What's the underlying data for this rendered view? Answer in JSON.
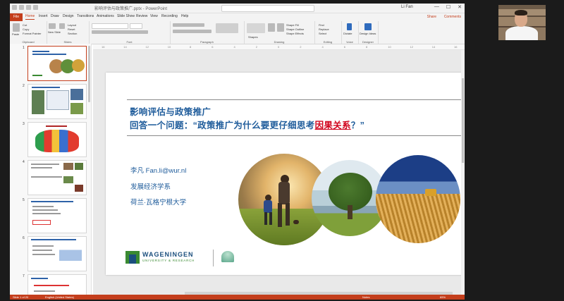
{
  "titlebar": {
    "doc_title": "影响评估与政策推广.pptx - PowerPoint",
    "user_name": "Li Fan",
    "minimize": "—",
    "maximize": "☐",
    "close": "✕"
  },
  "tabs": {
    "file": "File",
    "items": [
      "Home",
      "Insert",
      "Draw",
      "Design",
      "Transitions",
      "Animations",
      "Slide Show",
      "Review",
      "View",
      "Recording",
      "Help"
    ],
    "share": "Share",
    "comments": "Comments"
  },
  "ribbon": {
    "groups": [
      {
        "name": "Clipboard",
        "labels": [
          "Cut",
          "Copy",
          "Format Painter",
          "Paste"
        ]
      },
      {
        "name": "Slides",
        "labels": [
          "New Slide",
          "Reuse Slides",
          "Layout",
          "Reset",
          "Section"
        ]
      },
      {
        "name": "Font",
        "labels": []
      },
      {
        "name": "Paragraph",
        "labels": []
      },
      {
        "name": "Drawing",
        "labels": [
          "Shapes",
          "Arrange",
          "Quick Styles",
          "Shape Fill",
          "Shape Outline",
          "Shape Effects"
        ]
      },
      {
        "name": "Editing",
        "labels": [
          "Find",
          "Replace",
          "Select"
        ]
      },
      {
        "name": "Voice",
        "labels": [
          "Dictate"
        ]
      },
      {
        "name": "Designer",
        "labels": [
          "Design Ideas"
        ]
      }
    ]
  },
  "ruler": {
    "ticks": [
      "16",
      "14",
      "12",
      "10",
      "8",
      "6",
      "4",
      "2",
      "0",
      "2",
      "4",
      "6",
      "8",
      "10",
      "12",
      "14",
      "16"
    ]
  },
  "thumbnails": {
    "numbers": [
      "1",
      "2",
      "3",
      "4",
      "5",
      "6",
      "7"
    ],
    "selected_index": 0
  },
  "slide": {
    "title_line1": "影响评估与政策推广",
    "title_line2_pre": "回答一个问题：“政策推广为什么要更仔细思考",
    "title_line2_highlight": "因果关系",
    "title_line2_post": "？”",
    "author": "李凡   Fan.li@wur.nl",
    "department": "发展经济学系",
    "university": "荷兰·瓦格宁根大学",
    "logo_name": "WAGENINGEN",
    "logo_sub": "UNIVERSITY & RESEARCH"
  },
  "statusbar": {
    "slide_info": "Slide 1 of 20",
    "language": "English (United States)",
    "notes": "Notes",
    "zoom": "65%"
  },
  "colors": {
    "accent": "#c43e1c",
    "title_blue": "#1f5c9b",
    "highlight_red": "#d0021b"
  }
}
